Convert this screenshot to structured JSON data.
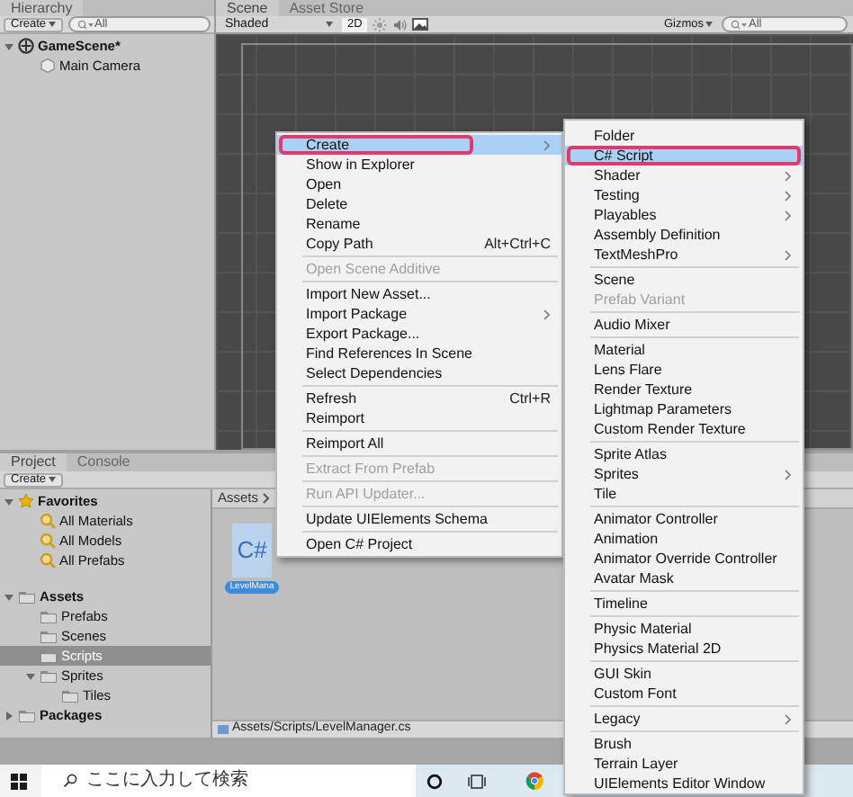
{
  "hierarchy": {
    "tab": "Hierarchy",
    "create_button": "Create",
    "search_placeholder": "All",
    "tree": [
      {
        "label": "GameScene*",
        "kind": "scene",
        "selected": false,
        "expanded": true,
        "children": [
          {
            "label": "Main Camera",
            "kind": "gameobject",
            "selected": false
          }
        ]
      }
    ]
  },
  "scene": {
    "tabs": [
      {
        "label": "Scene",
        "selected": true
      },
      {
        "label": "Asset Store",
        "selected": false
      }
    ],
    "shading_mode": "Shaded",
    "mode_2d": "2D",
    "gizmos": "Gizmos",
    "search_placeholder": "All"
  },
  "project": {
    "tabs": [
      {
        "label": "Project",
        "selected": true
      },
      {
        "label": "Console",
        "selected": false
      }
    ],
    "create_button": "Create",
    "tree": [
      {
        "label": "Favorites",
        "kind": "favorites",
        "selected": false,
        "expanded": true,
        "children": [
          {
            "label": "All Materials",
            "kind": "saved-search",
            "selected": false
          },
          {
            "label": "All Models",
            "kind": "saved-search",
            "selected": false
          },
          {
            "label": "All Prefabs",
            "kind": "saved-search",
            "selected": false
          }
        ]
      },
      {
        "label": "Assets",
        "kind": "folder",
        "selected": false,
        "expanded": true,
        "children": [
          {
            "label": "Prefabs",
            "kind": "folder",
            "selected": false
          },
          {
            "label": "Scenes",
            "kind": "folder",
            "selected": false
          },
          {
            "label": "Scripts",
            "kind": "folder",
            "selected": true
          },
          {
            "label": "Sprites",
            "kind": "folder",
            "selected": false,
            "expanded": true,
            "children": [
              {
                "label": "Tiles",
                "kind": "folder",
                "selected": false
              }
            ]
          }
        ]
      },
      {
        "label": "Packages",
        "kind": "folder",
        "selected": false,
        "expanded": false
      }
    ],
    "breadcrumb": "Assets",
    "asset": {
      "icon_label": "C#",
      "name": "LevelMana"
    },
    "path": "Assets/Scripts/LevelManager.cs"
  },
  "context_menu": {
    "groups": [
      [
        {
          "label": "Create",
          "selected": true,
          "disabled": false,
          "submenu": true
        },
        {
          "label": "Show in Explorer",
          "selected": false,
          "disabled": false,
          "submenu": false
        },
        {
          "label": "Open",
          "selected": false,
          "disabled": false,
          "submenu": false
        },
        {
          "label": "Delete",
          "selected": false,
          "disabled": false,
          "submenu": false
        },
        {
          "label": "Rename",
          "selected": false,
          "disabled": false,
          "submenu": false
        },
        {
          "label": "Copy Path",
          "shortcut": "Alt+Ctrl+C",
          "selected": false,
          "disabled": false,
          "submenu": false
        }
      ],
      [
        {
          "label": "Open Scene Additive",
          "selected": false,
          "disabled": true,
          "submenu": false
        }
      ],
      [
        {
          "label": "Import New Asset...",
          "selected": false,
          "disabled": false,
          "submenu": false
        },
        {
          "label": "Import Package",
          "selected": false,
          "disabled": false,
          "submenu": true
        },
        {
          "label": "Export Package...",
          "selected": false,
          "disabled": false,
          "submenu": false
        },
        {
          "label": "Find References In Scene",
          "selected": false,
          "disabled": false,
          "submenu": false
        },
        {
          "label": "Select Dependencies",
          "selected": false,
          "disabled": false,
          "submenu": false
        }
      ],
      [
        {
          "label": "Refresh",
          "shortcut": "Ctrl+R",
          "selected": false,
          "disabled": false,
          "submenu": false
        },
        {
          "label": "Reimport",
          "selected": false,
          "disabled": false,
          "submenu": false
        }
      ],
      [
        {
          "label": "Reimport All",
          "selected": false,
          "disabled": false,
          "submenu": false
        }
      ],
      [
        {
          "label": "Extract From Prefab",
          "selected": false,
          "disabled": true,
          "submenu": false
        }
      ],
      [
        {
          "label": "Run API Updater...",
          "selected": false,
          "disabled": true,
          "submenu": false
        }
      ],
      [
        {
          "label": "Update UIElements Schema",
          "selected": false,
          "disabled": false,
          "submenu": false
        }
      ],
      [
        {
          "label": "Open C# Project",
          "selected": false,
          "disabled": false,
          "submenu": false
        }
      ]
    ]
  },
  "create_submenu": {
    "groups": [
      [
        {
          "label": "Folder",
          "selected": false,
          "disabled": false,
          "submenu": false
        },
        {
          "label": "C# Script",
          "selected": true,
          "disabled": false,
          "submenu": false
        },
        {
          "label": "Shader",
          "selected": false,
          "disabled": false,
          "submenu": true
        },
        {
          "label": "Testing",
          "selected": false,
          "disabled": false,
          "submenu": true
        },
        {
          "label": "Playables",
          "selected": false,
          "disabled": false,
          "submenu": true
        },
        {
          "label": "Assembly Definition",
          "selected": false,
          "disabled": false,
          "submenu": false
        },
        {
          "label": "TextMeshPro",
          "selected": false,
          "disabled": false,
          "submenu": true
        }
      ],
      [
        {
          "label": "Scene",
          "selected": false,
          "disabled": false,
          "submenu": false
        },
        {
          "label": "Prefab Variant",
          "selected": false,
          "disabled": true,
          "submenu": false
        }
      ],
      [
        {
          "label": "Audio Mixer",
          "selected": false,
          "disabled": false,
          "submenu": false
        }
      ],
      [
        {
          "label": "Material",
          "selected": false,
          "disabled": false,
          "submenu": false
        },
        {
          "label": "Lens Flare",
          "selected": false,
          "disabled": false,
          "submenu": false
        },
        {
          "label": "Render Texture",
          "selected": false,
          "disabled": false,
          "submenu": false
        },
        {
          "label": "Lightmap Parameters",
          "selected": false,
          "disabled": false,
          "submenu": false
        },
        {
          "label": "Custom Render Texture",
          "selected": false,
          "disabled": false,
          "submenu": false
        }
      ],
      [
        {
          "label": "Sprite Atlas",
          "selected": false,
          "disabled": false,
          "submenu": false
        },
        {
          "label": "Sprites",
          "selected": false,
          "disabled": false,
          "submenu": true
        },
        {
          "label": "Tile",
          "selected": false,
          "disabled": false,
          "submenu": false
        }
      ],
      [
        {
          "label": "Animator Controller",
          "selected": false,
          "disabled": false,
          "submenu": false
        },
        {
          "label": "Animation",
          "selected": false,
          "disabled": false,
          "submenu": false
        },
        {
          "label": "Animator Override Controller",
          "selected": false,
          "disabled": false,
          "submenu": false
        },
        {
          "label": "Avatar Mask",
          "selected": false,
          "disabled": false,
          "submenu": false
        }
      ],
      [
        {
          "label": "Timeline",
          "selected": false,
          "disabled": false,
          "submenu": false
        }
      ],
      [
        {
          "label": "Physic Material",
          "selected": false,
          "disabled": false,
          "submenu": false
        },
        {
          "label": "Physics Material 2D",
          "selected": false,
          "disabled": false,
          "submenu": false
        }
      ],
      [
        {
          "label": "GUI Skin",
          "selected": false,
          "disabled": false,
          "submenu": false
        },
        {
          "label": "Custom Font",
          "selected": false,
          "disabled": false,
          "submenu": false
        }
      ],
      [
        {
          "label": "Legacy",
          "selected": false,
          "disabled": false,
          "submenu": true
        }
      ],
      [
        {
          "label": "Brush",
          "selected": false,
          "disabled": false,
          "submenu": false
        },
        {
          "label": "Terrain Layer",
          "selected": false,
          "disabled": false,
          "submenu": false
        },
        {
          "label": "UIElements Editor Window",
          "selected": false,
          "disabled": false,
          "submenu": false
        }
      ]
    ]
  },
  "taskbar": {
    "search_placeholder": "ここに入力して検索"
  }
}
